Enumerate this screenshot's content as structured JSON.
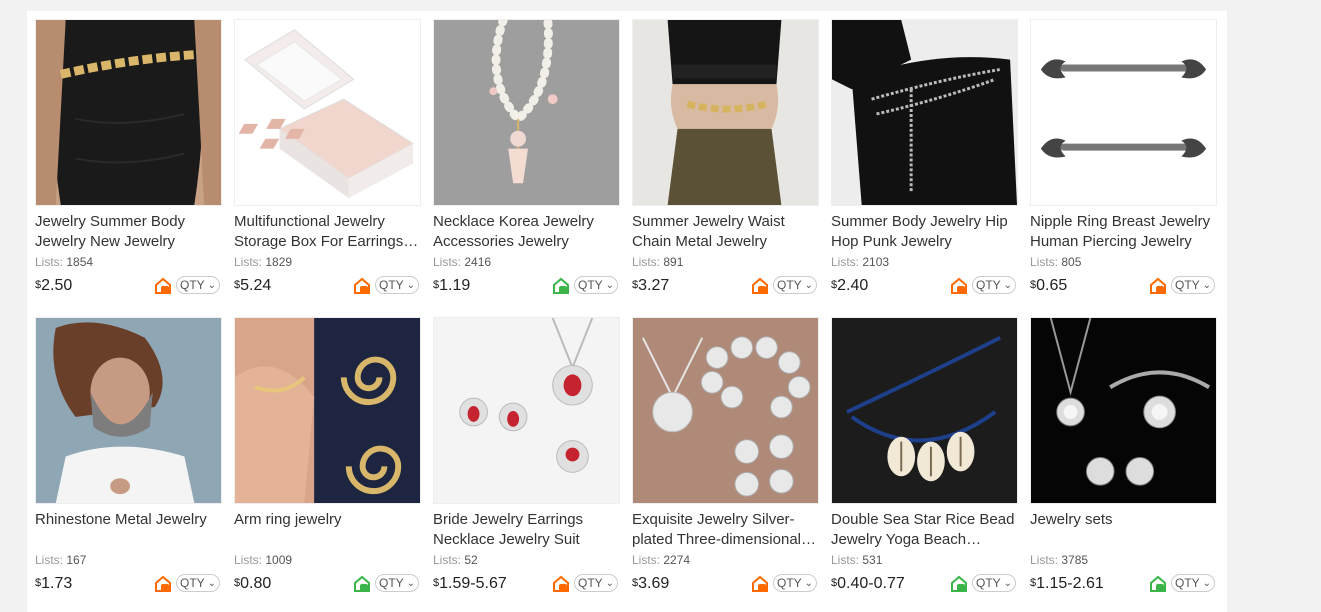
{
  "qty_label": "QTY",
  "lists_label": "Lists:",
  "currency": "$",
  "products": [
    {
      "title": "Jewelry Summer Body Jewelry New Jewelry",
      "lists": "1854",
      "price": "2.50",
      "badge": "orange"
    },
    {
      "title": "Multifunctional Jewelry Storage Box For Earrings, Necklaces",
      "lists": "1829",
      "price": "5.24",
      "badge": "orange"
    },
    {
      "title": "Necklace Korea Jewelry Accessories Jewelry",
      "lists": "2416",
      "price": "1.19",
      "badge": "green"
    },
    {
      "title": "Summer Jewelry Waist Chain Metal Jewelry",
      "lists": "891",
      "price": "3.27",
      "badge": "orange"
    },
    {
      "title": "Summer Body Jewelry Hip Hop Punk Jewelry",
      "lists": "2103",
      "price": "2.40",
      "badge": "orange"
    },
    {
      "title": "Nipple Ring Breast Jewelry Human Piercing Jewelry",
      "lists": "805",
      "price": "0.65",
      "badge": "orange"
    },
    {
      "title": "Rhinestone Metal Jewelry",
      "lists": "167",
      "price": "1.73",
      "badge": "orange"
    },
    {
      "title": "Arm ring jewelry",
      "lists": "1009",
      "price": "0.80",
      "badge": "green"
    },
    {
      "title": "Bride Jewelry Earrings Necklace Jewelry Suit",
      "lists": "52",
      "price": "1.59-5.67",
      "badge": "orange"
    },
    {
      "title": "Exquisite Jewelry Silver-plated Three-dimensional Jewelry Set",
      "lists": "2274",
      "price": "3.69",
      "badge": "orange"
    },
    {
      "title": "Double Sea Star Rice Bead Jewelry Yoga Beach Jewelry",
      "lists": "531",
      "price": "0.40-0.77",
      "badge": "green"
    },
    {
      "title": "Jewelry sets",
      "lists": "3785",
      "price": "1.15-2.61",
      "badge": "green"
    }
  ],
  "colors": {
    "orange": "#ff6a00",
    "green": "#3bb54a"
  }
}
